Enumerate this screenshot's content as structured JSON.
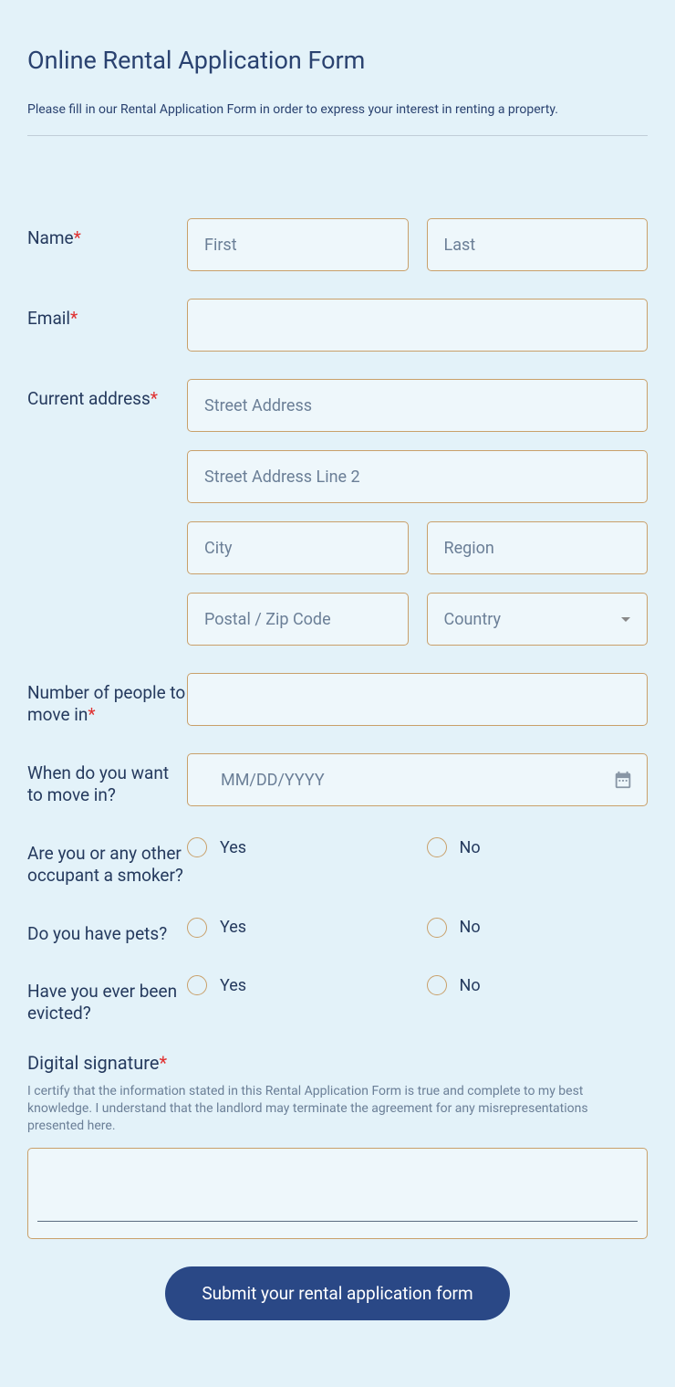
{
  "header": {
    "title": "Online Rental Application Form",
    "subtitle": "Please fill in our Rental Application Form in order to express your interest in renting a property."
  },
  "labels": {
    "name": "Name",
    "email": "Email",
    "address": "Current address",
    "people": "Number of people to move in",
    "move_date": "When do you want to move in?",
    "smoker": "Are you or any other occupant a smoker?",
    "pets": "Do you have pets?",
    "evicted": "Have you ever been evicted?",
    "signature": "Digital signature"
  },
  "placeholders": {
    "first": "First",
    "last": "Last",
    "street": "Street Address",
    "street2": "Street Address Line 2",
    "city": "City",
    "region": "Region",
    "postal": "Postal / Zip Code",
    "country": "Country",
    "date": "MM/DD/YYYY"
  },
  "options": {
    "yes": "Yes",
    "no": "No"
  },
  "signature_helper": "I certify that the information stated in this Rental Application Form is true and complete to my best knowledge. I understand that the landlord may terminate the agreement for any misrepresentations presented here.",
  "submit": "Submit your rental application form"
}
